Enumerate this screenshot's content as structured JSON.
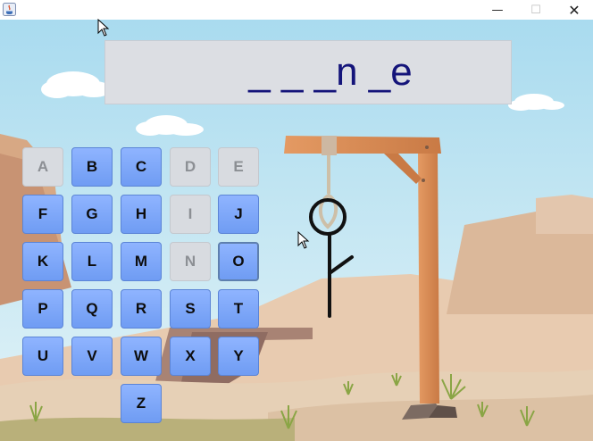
{
  "window": {
    "title": "",
    "controls": {
      "minimize": "—",
      "maximize": "☐",
      "close": "✕"
    }
  },
  "word": {
    "display": "_ _ _n _e"
  },
  "keyboard": {
    "keys": [
      {
        "label": "A",
        "state": "used"
      },
      {
        "label": "B",
        "state": "available"
      },
      {
        "label": "C",
        "state": "available"
      },
      {
        "label": "D",
        "state": "used"
      },
      {
        "label": "E",
        "state": "used"
      },
      {
        "label": "F",
        "state": "available"
      },
      {
        "label": "G",
        "state": "available"
      },
      {
        "label": "H",
        "state": "available"
      },
      {
        "label": "I",
        "state": "used"
      },
      {
        "label": "J",
        "state": "available"
      },
      {
        "label": "K",
        "state": "available"
      },
      {
        "label": "L",
        "state": "available"
      },
      {
        "label": "M",
        "state": "available"
      },
      {
        "label": "N",
        "state": "used"
      },
      {
        "label": "O",
        "state": "available"
      },
      {
        "label": "P",
        "state": "available"
      },
      {
        "label": "Q",
        "state": "available"
      },
      {
        "label": "R",
        "state": "available"
      },
      {
        "label": "S",
        "state": "available"
      },
      {
        "label": "T",
        "state": "available"
      },
      {
        "label": "U",
        "state": "available"
      },
      {
        "label": "V",
        "state": "available"
      },
      {
        "label": "W",
        "state": "available"
      },
      {
        "label": "X",
        "state": "available"
      },
      {
        "label": "Y",
        "state": "available"
      },
      {
        "label": "Z",
        "state": "available"
      }
    ],
    "focused": "O"
  },
  "hangman": {
    "wrong_guesses_drawn": [
      "head",
      "body",
      "arm"
    ]
  },
  "colors": {
    "sky_top": "#aadcf0",
    "sky_bottom": "#e0f2f7",
    "key_available": "#7ea6f8",
    "key_used": "#d8dbe0",
    "word_text": "#14147a",
    "gallows_wood": "#d98a55"
  }
}
